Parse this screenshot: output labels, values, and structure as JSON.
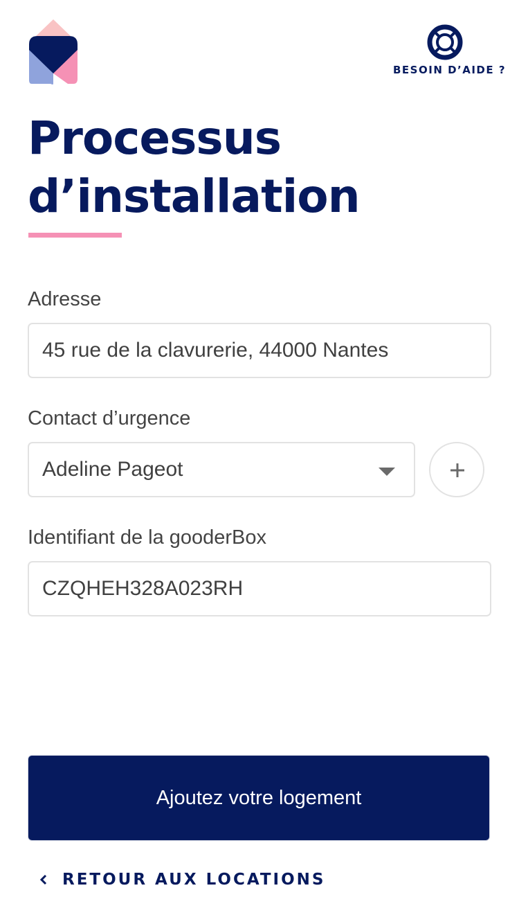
{
  "header": {
    "logo": "gooder-logo",
    "help_icon": "lifebuoy-icon",
    "help_label": "BESOIN D’AIDE ?"
  },
  "page": {
    "title_line1": "Processus",
    "title_line2": "d’installation"
  },
  "form": {
    "address": {
      "label": "Adresse",
      "value": "45 rue de la clavurerie, 44000 Nantes"
    },
    "emergency_contact": {
      "label": "Contact d’urgence",
      "value": "Adeline Pageot",
      "add_icon": "plus-icon"
    },
    "box_id": {
      "label": "Identifiant de la gooderBox",
      "value": "CZQHEH328A023RH"
    }
  },
  "actions": {
    "submit_label": "Ajoutez votre logement",
    "back_label": "RETOUR AUX LOCATIONS",
    "back_icon": "chevron-left-icon"
  },
  "colors": {
    "navy": "#061a5e",
    "pink": "#f591b5",
    "light_pink": "#f9c3c4",
    "periwinkle": "#8fa3dc",
    "border": "#e2e2e2"
  }
}
